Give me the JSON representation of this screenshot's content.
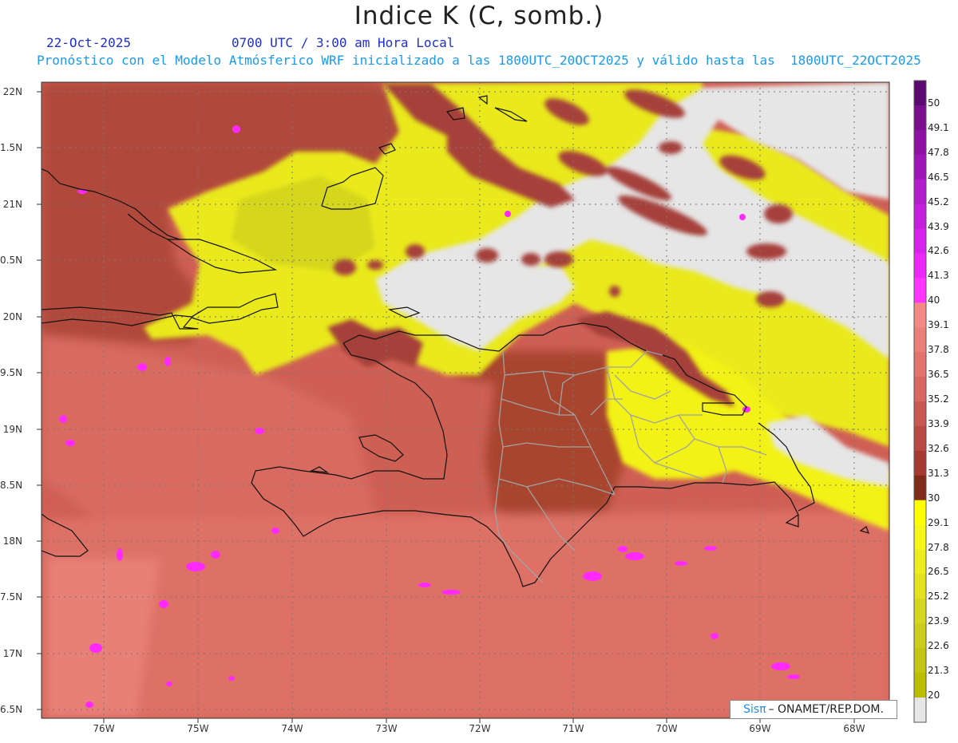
{
  "title": "Indice K (C, somb.)",
  "header": {
    "date": "22-Oct-2025",
    "time": "0700 UTC / 3:00 am Hora Local",
    "description": "Pronóstico con el Modelo Atmósferico WRF inicializado a las 1800UTC_20OCT2025 y válido hasta las  1800UTC_22OCT2025"
  },
  "map": {
    "lat_labels": [
      "22N",
      "1.5N",
      "21N",
      "0.5N",
      "20N",
      "9.5N",
      "19N",
      "8.5N",
      "18N",
      "7.5N",
      "17N",
      "6.5N"
    ],
    "lon_labels": [
      "76W",
      "75W",
      "74W",
      "73W",
      "72W",
      "71W",
      "70W",
      "69W",
      "68W"
    ],
    "colors": {
      "frame": "#333333",
      "land_outline": "#111111",
      "province_outline": "#a0a0a0",
      "grid": "#888888",
      "no_data": "#e6e6e6"
    }
  },
  "colorbar": {
    "labels": [
      "50",
      "49.1",
      "47.8",
      "46.5",
      "45.2",
      "43.9",
      "42.6",
      "41.3",
      "40",
      "39.1",
      "37.8",
      "36.5",
      "35.2",
      "33.9",
      "32.6",
      "31.3",
      "30",
      "29.1",
      "27.8",
      "26.5",
      "25.2",
      "23.9",
      "22.6",
      "21.3",
      "20"
    ],
    "colors": [
      "#5a0a6e",
      "#7a0e8c",
      "#8d12a4",
      "#9e16b8",
      "#b11ccc",
      "#c31fdc",
      "#d622ea",
      "#ec27f7",
      "#ff35ff",
      "#f48a86",
      "#ec7f79",
      "#e3746d",
      "#d86661",
      "#c95852",
      "#b84944",
      "#a53a33",
      "#7e2b17",
      "#ffff00",
      "#f6f61a",
      "#ecec1e",
      "#e2e220",
      "#d6d622",
      "#cccc1e",
      "#c4c414",
      "#bcbc00",
      "#e6e6e6"
    ]
  },
  "credit": {
    "logo_text": "Sisπ",
    "text": "– ONAMET/REP.DOM."
  }
}
